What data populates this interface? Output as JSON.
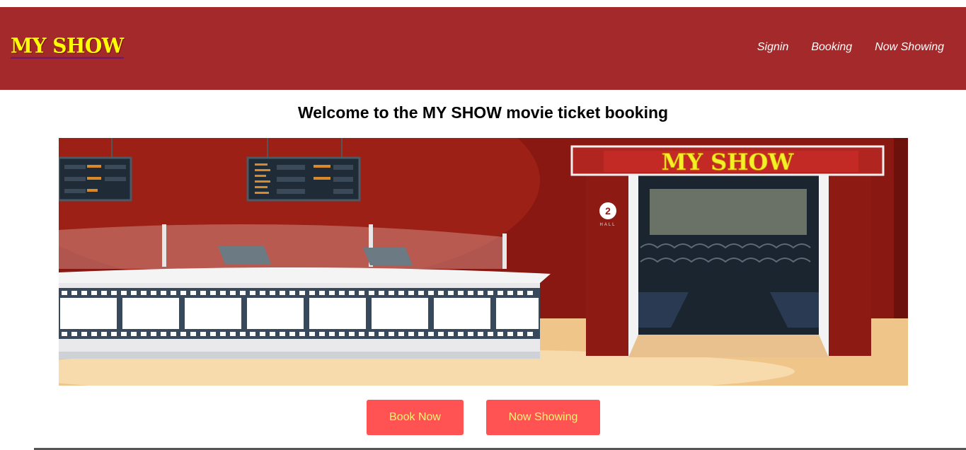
{
  "header": {
    "logo": "MY SHOW",
    "nav": [
      {
        "label": "Signin"
      },
      {
        "label": "Booking"
      },
      {
        "label": "Now Showing"
      }
    ]
  },
  "main": {
    "welcome": "Welcome to the MY SHOW movie ticket booking",
    "hero_sign": "MY SHOW",
    "hall_number": "2",
    "hall_label": "HALL",
    "buttons": {
      "book_now": "Book Now",
      "now_showing": "Now Showing"
    }
  },
  "colors": {
    "header_bg": "#a4292a",
    "logo": "#ffff00",
    "button_bg": "#ff5252",
    "button_text": "#fff176"
  }
}
